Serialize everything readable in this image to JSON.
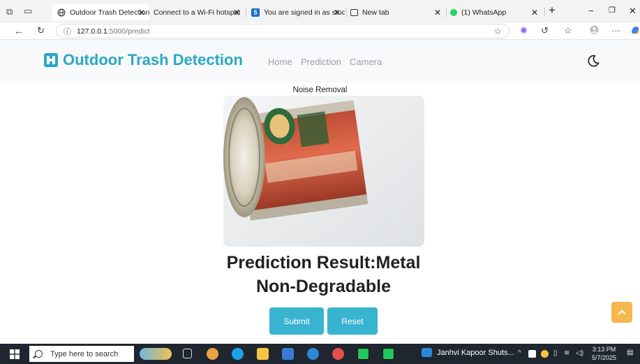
{
  "browser": {
    "tabs": [
      {
        "label": "Outdoor Trash Detection",
        "icon": "globe-icon",
        "active": true
      },
      {
        "label": "Connect to a Wi-Fi hotspot",
        "icon": "none",
        "active": false
      },
      {
        "label": "You are signed in as stud",
        "icon": "s-app-icon",
        "active": false
      },
      {
        "label": "New tab",
        "icon": "new-tab-icon",
        "active": false
      },
      {
        "label": "(1) WhatsApp",
        "icon": "whatsapp-icon",
        "active": false
      }
    ],
    "url_host": "127.0.0.1",
    "url_path": ":5000/predict"
  },
  "site": {
    "brand": "Outdoor Trash Detection",
    "nav": [
      "Home",
      "Prediction",
      "Camera"
    ]
  },
  "main": {
    "image_caption": "Noise Removal",
    "result_line1": "Prediction Result:Metal",
    "result_line2": "Non-Degradable",
    "submit_label": "Submit",
    "reset_label": "Reset"
  },
  "taskbar": {
    "search_placeholder": "Type here to search",
    "active_task": "Janhvi Kapoor Shuts...",
    "time": "3:13 PM",
    "date": "5/7/2025"
  },
  "colors": {
    "brand": "#2aa8c4",
    "button": "#39b4d0",
    "scroll_top": "#f6b84a",
    "navbar_bg": "#f8f9fa"
  }
}
